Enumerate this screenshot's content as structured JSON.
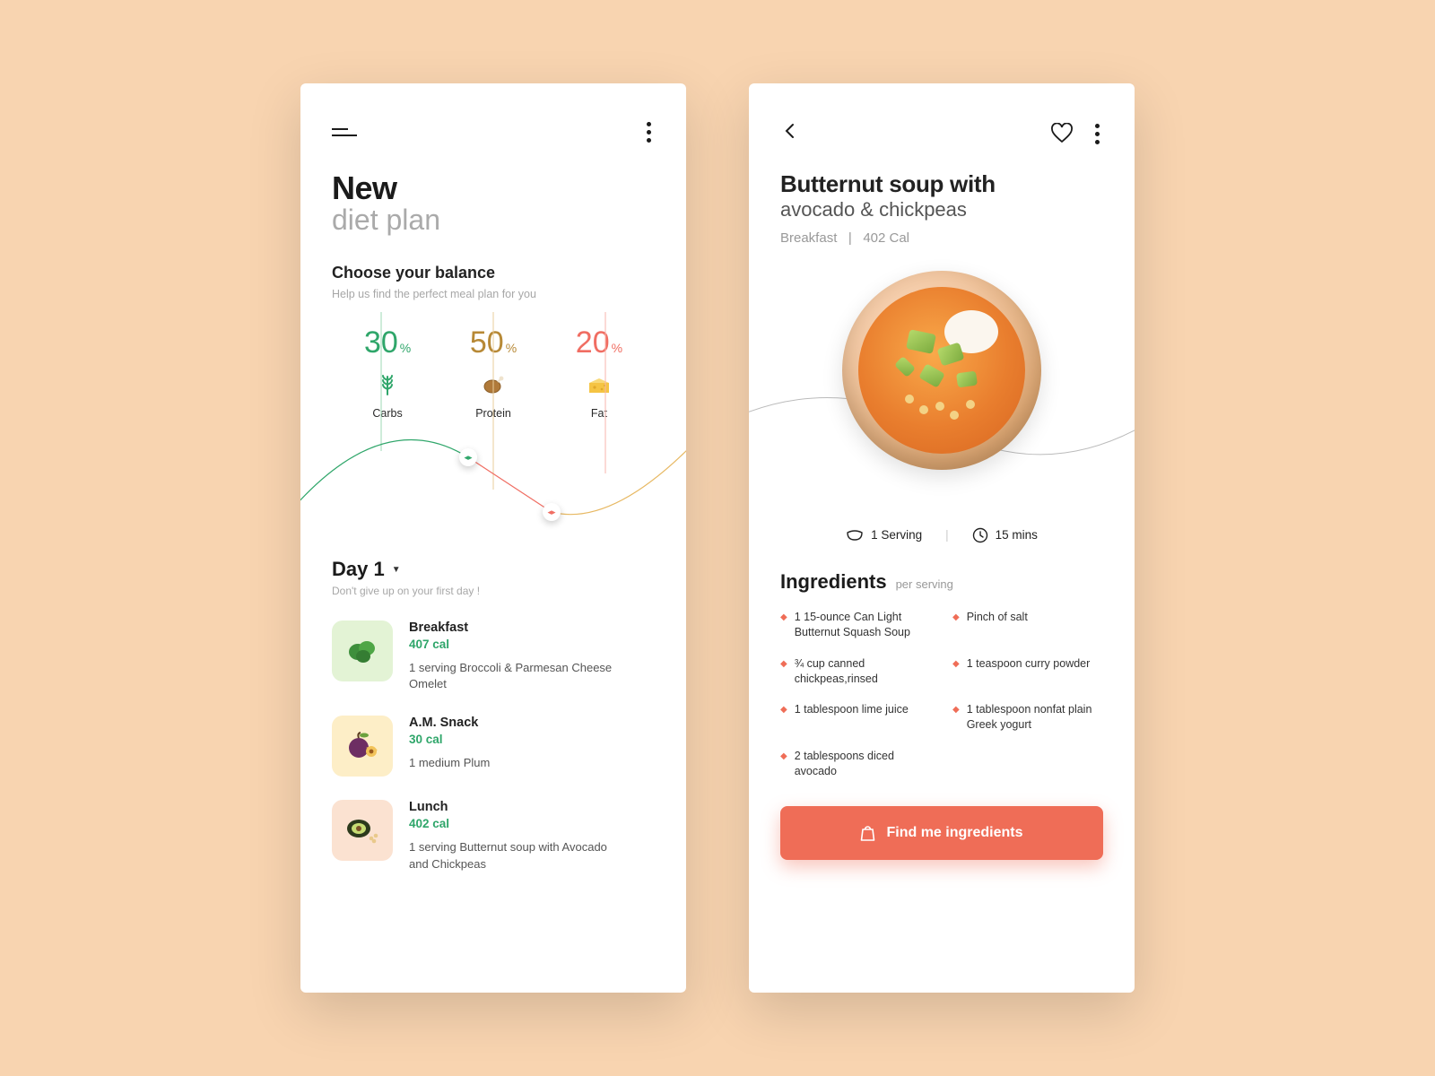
{
  "left": {
    "title_bold": "New",
    "title_light": "diet plan",
    "balance_head": "Choose your balance",
    "balance_sub": "Help us find the perfect meal plan for you",
    "balance": [
      {
        "pct": "30",
        "label": "Carbs",
        "icon": "wheat-icon",
        "color": "#2fa66a"
      },
      {
        "pct": "50",
        "label": "Protein",
        "icon": "chicken-icon",
        "color": "#b78936"
      },
      {
        "pct": "20",
        "label": "Fat",
        "icon": "cheese-icon",
        "color": "#f2b63a"
      }
    ],
    "day_label": "Day 1",
    "day_sub": "Don't give up on your first day !",
    "meals": [
      {
        "name": "Breakfast",
        "cal": "407 cal",
        "desc": "1 serving Broccoli & Parmesan Cheese Omelet",
        "thumb_class": "green"
      },
      {
        "name": "A.M. Snack",
        "cal": "30 cal",
        "desc": "1 medium Plum",
        "thumb_class": "yellow"
      },
      {
        "name": "Lunch",
        "cal": "402 cal",
        "desc": "1 serving Butternut soup with Avocado and Chickpeas",
        "thumb_class": "peach"
      }
    ]
  },
  "right": {
    "title_bold": "Butternut soup with",
    "title_light": "avocado & chickpeas",
    "meta_meal": "Breakfast",
    "meta_sep": "|",
    "meta_cal": "402 Cal",
    "serving": "1 Serving",
    "time": "15 mins",
    "ing_head": "Ingredients",
    "ing_per": "per serving",
    "ingredients": [
      "1 15-ounce Can Light Butternut Squash Soup",
      "Pinch of salt",
      "¾ cup canned chickpeas,rinsed",
      "1 teaspoon curry powder",
      "1 tablespoon lime juice",
      "1 tablespoon nonfat plain Greek yogurt",
      "2 tablespoons diced avocado"
    ],
    "cta": "Find me ingredients"
  }
}
